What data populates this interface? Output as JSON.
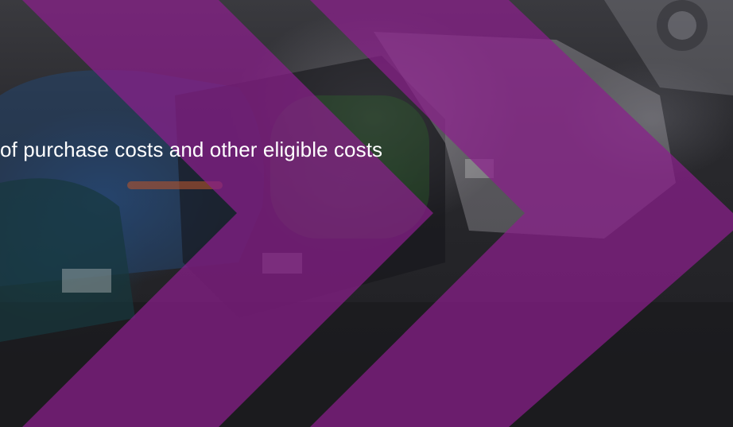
{
  "slide": {
    "caption": "of purchase costs and other eligible costs",
    "background_subject": "parked-cars-photo",
    "accent_color": "#8b1f8c",
    "caption_color": "#ffffff"
  }
}
